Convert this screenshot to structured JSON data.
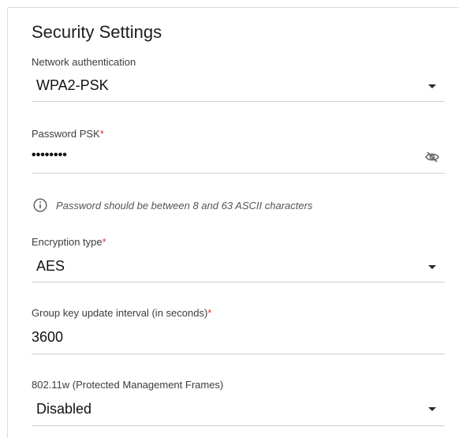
{
  "section": {
    "title": "Security Settings"
  },
  "network_auth": {
    "label": "Network authentication",
    "value": "WPA2-PSK"
  },
  "password_psk": {
    "label": "Password PSK",
    "required_mark": "*",
    "value": "••••••••",
    "toggle_icon": "eye-slash-icon"
  },
  "hint": {
    "icon": "info-icon",
    "text": "Password should be between 8 and 63 ASCII characters"
  },
  "encryption": {
    "label": "Encryption type",
    "required_mark": "*",
    "value": "AES"
  },
  "group_key": {
    "label": "Group key update interval (in seconds)",
    "required_mark": "*",
    "value": "3600"
  },
  "pmf": {
    "label": "802.11w (Protected Management Frames)",
    "value": "Disabled"
  },
  "colors": {
    "required": "#e0312b",
    "underline": "#cfcfcf",
    "text": "#111111",
    "label": "#3c3c3c"
  }
}
